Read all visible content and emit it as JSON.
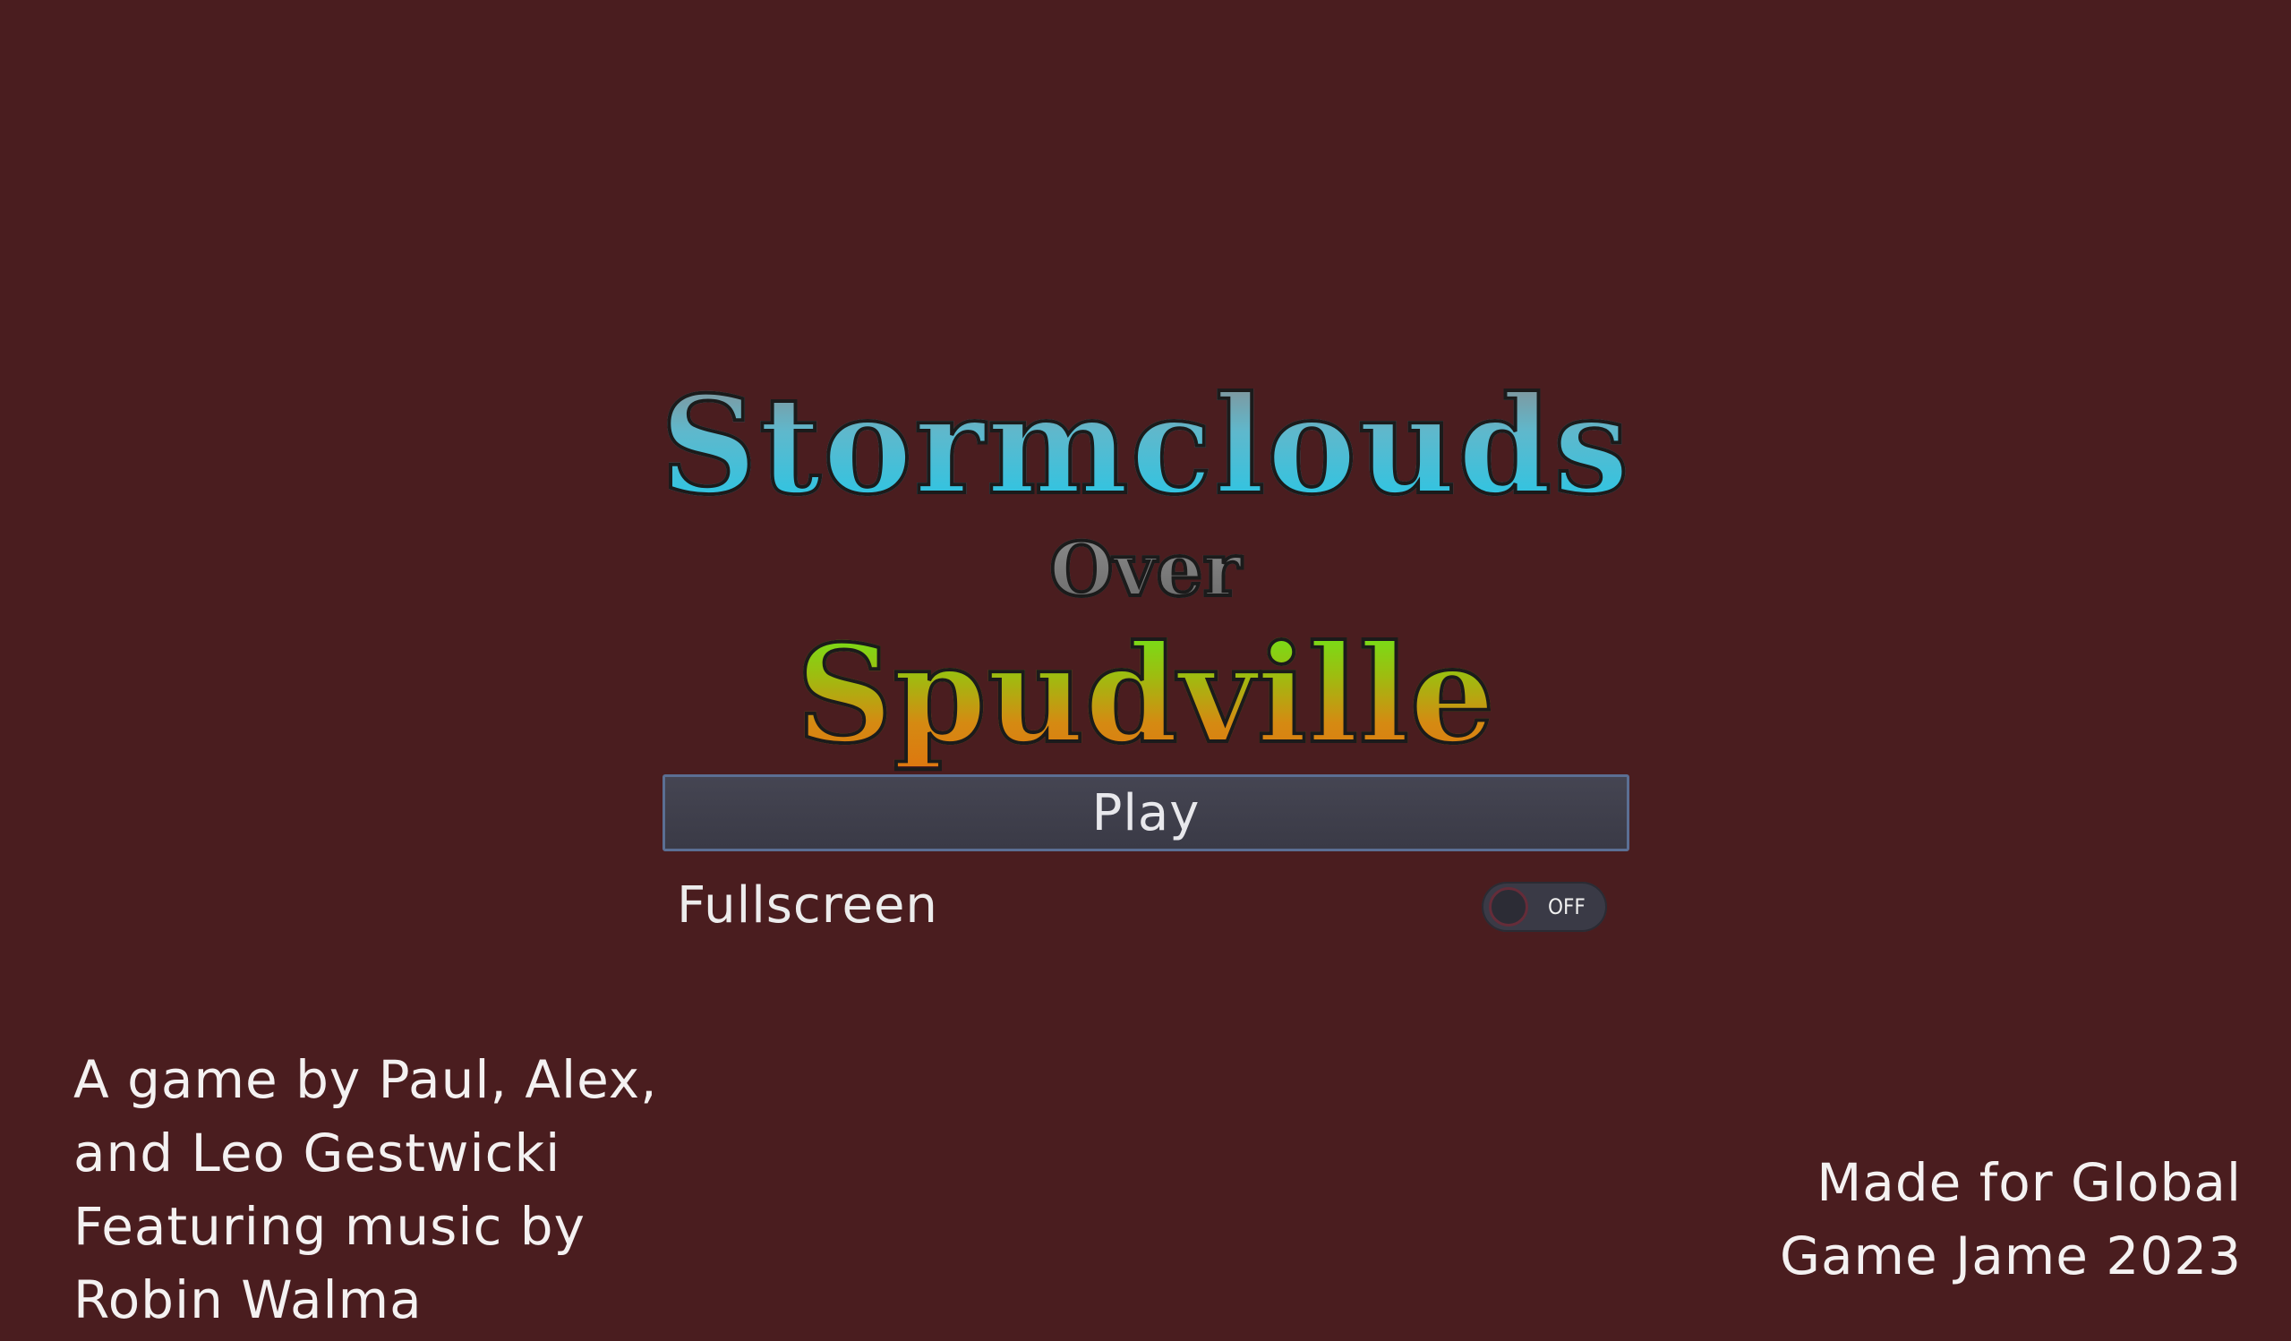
{
  "title": {
    "line1": "Stormclouds",
    "line2": "Over",
    "line3": "Spudville"
  },
  "menu": {
    "play_label": "Play",
    "fullscreen_label": "Fullscreen",
    "fullscreen_toggle_state": "OFF",
    "fullscreen_enabled": false
  },
  "credits": {
    "line1": "A game by Paul, Alex,",
    "line2": "and Leo Gestwicki",
    "line3": "Featuring music by",
    "line4": "Robin Walma"
  },
  "event": {
    "line1": "Made for Global",
    "line2": "Game Jame 2023"
  },
  "colors": {
    "background": "#4a1d1f",
    "button_fill": "#3f3f4c",
    "button_border": "#5b6f93",
    "text": "#f4f1f1"
  }
}
